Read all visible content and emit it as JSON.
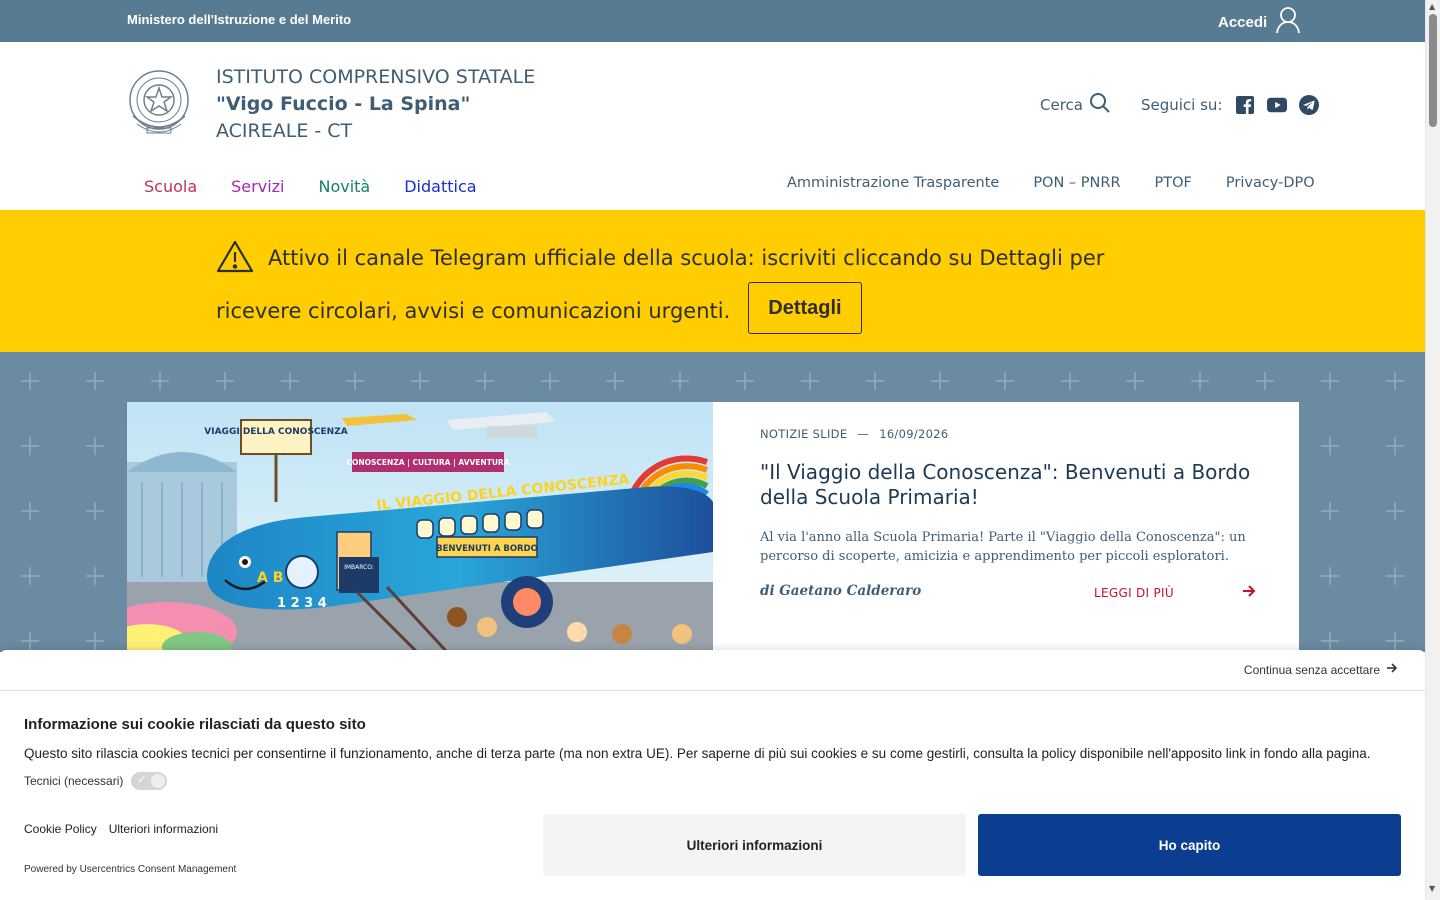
{
  "topbar": {
    "ministry": "Ministero dell'Istruzione e del Merito",
    "login_label": "Accedi",
    "login_icon": "user-icon"
  },
  "header": {
    "line1": "ISTITUTO COMPRENSIVO STATALE",
    "line2": "\"Vigo Fuccio - La Spina\"",
    "line3": "ACIREALE - CT",
    "search_label": "Cerca",
    "follow_label": "Seguici su:",
    "social": [
      "facebook-icon",
      "youtube-icon",
      "telegram-icon"
    ]
  },
  "mainnav": [
    {
      "label": "Scuola",
      "color": "#c1324f"
    },
    {
      "label": "Servizi",
      "color": "#a327b8"
    },
    {
      "label": "Novità",
      "color": "#12836a"
    },
    {
      "label": "Didattica",
      "color": "#1a2ccf"
    }
  ],
  "secnav": [
    "Amministrazione Trasparente",
    "PON – PNRR",
    "PTOF",
    "Privacy-DPO"
  ],
  "alert": {
    "text": "Attivo il canale Telegram ufficiale della scuola: iscriviti cliccando su Dettagli per ricevere circolari, avvisi e comunicazioni urgenti.",
    "button": "Dettagli",
    "background": "#ffcd00"
  },
  "hero": {
    "category": "NOTIZIE SLIDE",
    "separator": "—",
    "date": "16/09/2026",
    "title": "\"Il Viaggio della Conoscenza\": Benvenuti a Bordo della Scuola Primaria!",
    "description": "Al via l'anno alla Scuola Primaria! Parte il \"Viaggio della Conoscenza\": un percorso di scoperte, amicizia e apprendimento per piccoli esploratori.",
    "author": "di Gaetano Calderaro",
    "read_more": "LEGGI DI PIÙ",
    "image_texts": {
      "sign": "VIAGGI DELLA CONOSCENZA",
      "banner": "CONOSCENZA | CULTURA | AVVENTURA",
      "plane_name": "IL VIAGGIO DELLA CONOSCENZA",
      "welcome": "BENVENUTI A BORDO",
      "boarding": "IMBARCO:",
      "numbers": "1 2 3 4",
      "letters": "A B C"
    }
  },
  "cookie": {
    "continue": "Continua senza accettare",
    "title": "Informazione sui cookie rilasciati da questo sito",
    "text": "Questo sito rilascia cookies tecnici per consentirne il funzionamento, anche di terza parte (ma non extra UE). Per saperne di più sui cookies e su come gestirli, consulta la policy disponibile nell'apposito link in fondo alla pagina.",
    "toggle_label": "Tecnici (necessari)",
    "link_policy": "Cookie Policy",
    "link_info": "Ulteriori informazioni",
    "powered": "Powered by Usercentrics Consent Management",
    "btn_info": "Ulteriori informazioni",
    "btn_ok": "Ho capito",
    "accent": "#0b3d91"
  }
}
